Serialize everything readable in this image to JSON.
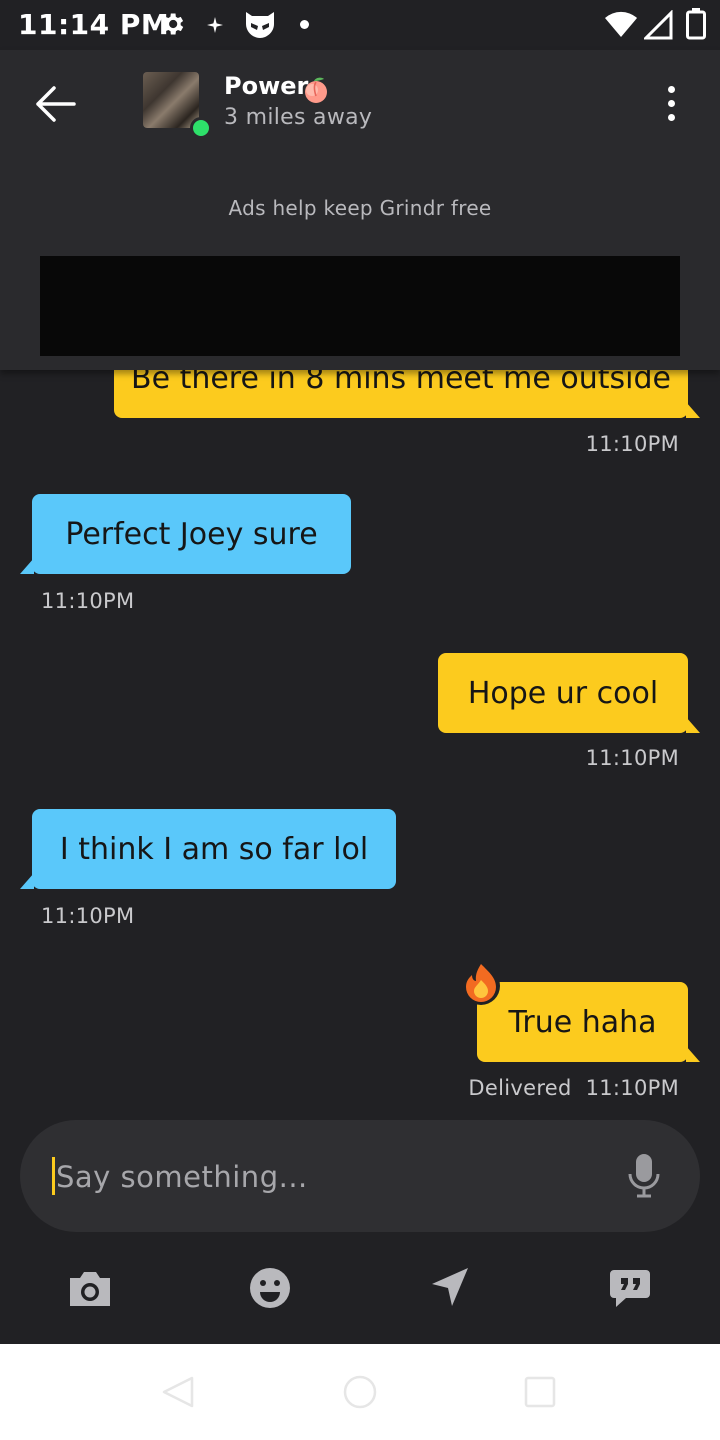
{
  "status_bar": {
    "time": "11:14 PM",
    "icons": [
      "gear-icon",
      "sparkle-icon",
      "grindr-mask-icon",
      "dot-icon",
      "wifi-icon",
      "cell-signal-icon",
      "battery-icon"
    ]
  },
  "header": {
    "profile_name": "Power",
    "name_emoji": "peach-emoji",
    "distance": "3 miles away",
    "online": true,
    "ads_text": "Ads help keep Grindr free"
  },
  "messages": [
    {
      "side": "out",
      "text": "Be there in 8 mins meet me outside",
      "time": "11:10PM"
    },
    {
      "side": "in",
      "text": "Perfect Joey sure",
      "time": "11:10PM"
    },
    {
      "side": "out",
      "text": "Hope ur cool",
      "time": "11:10PM"
    },
    {
      "side": "in",
      "text": "I think I am so far lol",
      "time": "11:10PM"
    },
    {
      "side": "out",
      "text": "True haha",
      "time": "11:10PM",
      "status": "Delivered",
      "reaction": "fire-emoji"
    }
  ],
  "composer": {
    "placeholder": "Say something...",
    "value": ""
  },
  "toolbar": {
    "icons": [
      "camera-icon",
      "emoji-icon",
      "location-icon",
      "saved-phrases-icon"
    ]
  },
  "colors": {
    "background": "#212124",
    "header": "#2a2a2d",
    "outgoing_bubble": "#fccb1e",
    "incoming_bubble": "#5ac8fa",
    "online": "#2ee06a"
  }
}
